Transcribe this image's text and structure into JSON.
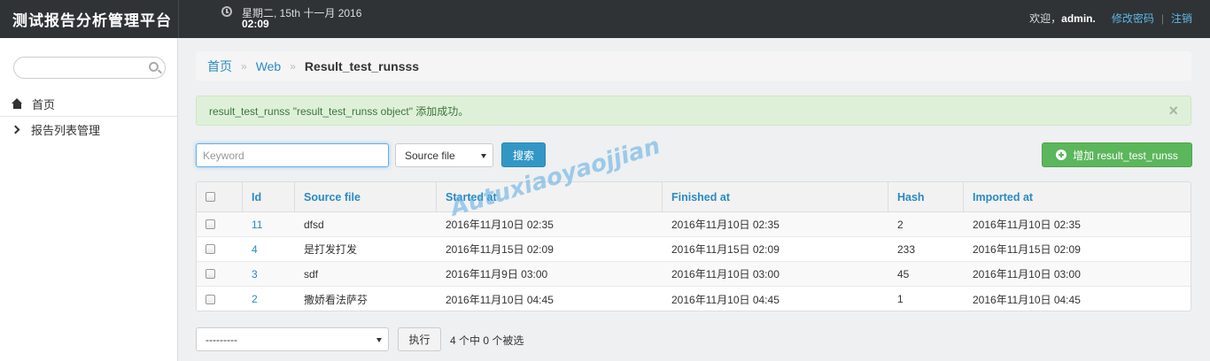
{
  "header": {
    "brand": "测试报告分析管理平台",
    "date": "星期二, 15th 十一月 2016",
    "time": "02:09",
    "welcome": "欢迎，",
    "username": "admin.",
    "change_password": "修改密码",
    "divider": "|",
    "logout": "注销"
  },
  "sidebar": {
    "search_placeholder": "",
    "items": [
      {
        "label": "首页",
        "icon": "home-icon"
      },
      {
        "label": "报告列表管理",
        "icon": "chevron-right-icon"
      }
    ]
  },
  "breadcrumb": {
    "home": "首页",
    "sep": "»",
    "section": "Web",
    "current": "Result_test_runsss"
  },
  "alert": {
    "message": "result_test_runss \"result_test_runss object\" 添加成功。",
    "close": "×"
  },
  "toolbar": {
    "keyword_placeholder": "Keyword",
    "source_select": "Source file",
    "search_label": "搜索",
    "add_label": "增加 result_test_runss"
  },
  "table": {
    "columns": [
      "Id",
      "Source file",
      "Started at",
      "Finished at",
      "Hash",
      "Imported at"
    ],
    "rows": [
      {
        "id": "11",
        "source": "dfsd",
        "started": "2016年11月10日 02:35",
        "finished": "2016年11月10日 02:35",
        "hash": "2",
        "imported": "2016年11月10日 02:35"
      },
      {
        "id": "4",
        "source": "是打发打发",
        "started": "2016年11月15日 02:09",
        "finished": "2016年11月15日 02:09",
        "hash": "233",
        "imported": "2016年11月15日 02:09"
      },
      {
        "id": "3",
        "source": "sdf",
        "started": "2016年11月9日 03:00",
        "finished": "2016年11月10日 03:00",
        "hash": "45",
        "imported": "2016年11月10日 03:00"
      },
      {
        "id": "2",
        "source": "撒娇看法萨芬",
        "started": "2016年11月10日 04:45",
        "finished": "2016年11月10日 04:45",
        "hash": "1",
        "imported": "2016年11月10日 04:45"
      }
    ]
  },
  "watermark": "Autuxiaoyaojjian",
  "footer": {
    "action_select": "---------",
    "run_label": "执行",
    "selected_count": "4 个中 0 个被选"
  },
  "colors": {
    "topbar": "#2f3336",
    "link": "#2a8ac3",
    "success_bg": "#dff0d8",
    "primary_button": "#3397c6",
    "add_button": "#5cb65c"
  }
}
